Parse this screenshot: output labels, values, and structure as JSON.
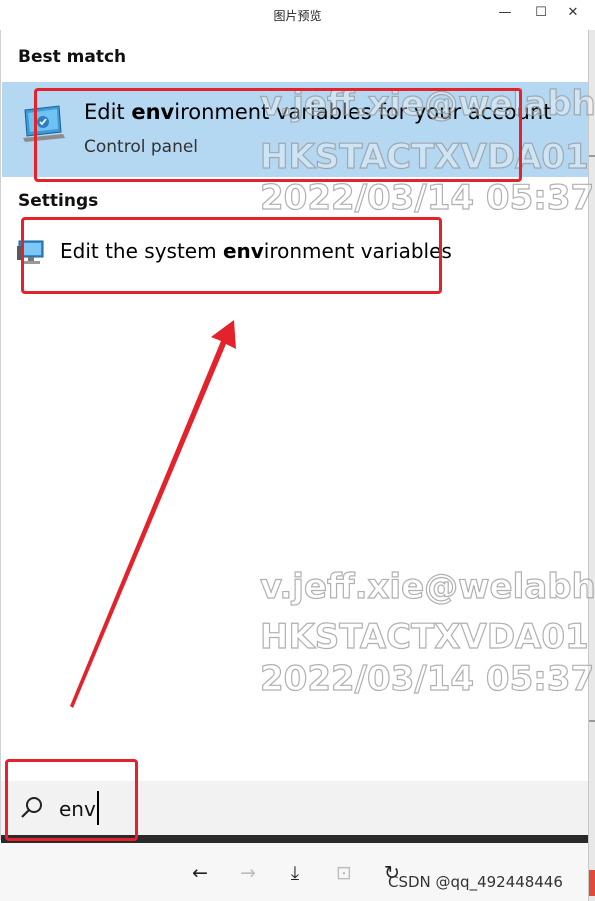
{
  "window": {
    "title": "图片预览",
    "minimize_glyph": "—",
    "maximize_glyph": "☐",
    "close_glyph": "✕"
  },
  "sections": {
    "best_match": "Best match",
    "settings": "Settings"
  },
  "best_match_item": {
    "title_prefix": "Edit ",
    "title_bold": "env",
    "title_suffix": "ironment variables for your account",
    "subtitle": "Control panel",
    "icon": "control-panel-monitor-icon"
  },
  "settings_item": {
    "title_prefix": "Edit the system ",
    "title_bold": "env",
    "title_suffix": "ironment variables",
    "icon": "system-settings-monitor-icon"
  },
  "search": {
    "value": "env",
    "icon": "search-icon"
  },
  "toolbar": {
    "back": "←",
    "forward": "→",
    "download": "⤓",
    "fit": "⊡",
    "rotate": "↻",
    "credit": "CSDN @qq_492448446"
  },
  "watermark": {
    "line1": "v.jeff.xie@welabhk",
    "line2": "HKSTACTXVDA01",
    "line3": "2022/03/14 05:37"
  },
  "annotation_color": "#e4222b",
  "selection_color": "#b4d7f2"
}
